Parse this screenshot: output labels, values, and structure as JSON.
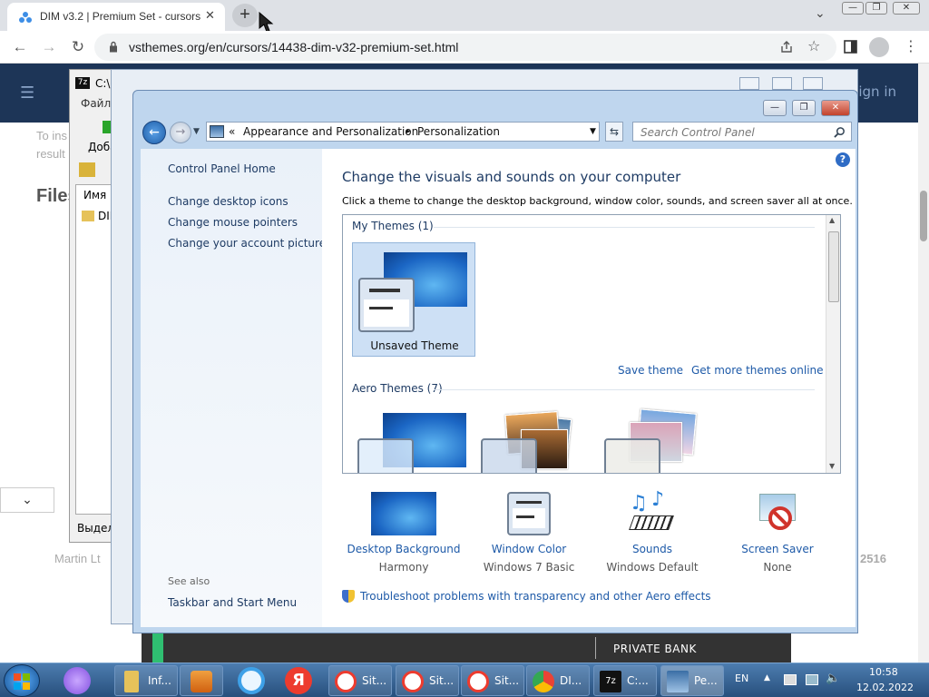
{
  "browser": {
    "tab_title": "DIM v3.2 | Premium Set - cursors",
    "tab_close": "✕",
    "new_tab": "+",
    "url": "vsthemes.org/en/cursors/14438-dim-v32-premium-set.html",
    "window_buttons": [
      "—",
      "❐",
      "✕"
    ],
    "nav": {
      "back": "←",
      "forward": "→",
      "reload": "↻"
    },
    "chevron": "⌄"
  },
  "site": {
    "login": "Sign in",
    "files_heading": "Files",
    "fragment_1": "To ins",
    "fragment_2": "result",
    "fragment_author": "Martin Lt",
    "fragment_num": "2516",
    "download_chevron": "⌄",
    "ad_text": "PRIVATE BANK"
  },
  "zip": {
    "title_fragment": "C:\\",
    "menu_file": "Файл",
    "add_label": "Доба",
    "column_name": "Имя",
    "folder_name": "DIM",
    "status": "Выдел"
  },
  "control_panel": {
    "breadcrumb_prefix": "«",
    "breadcrumb_1": "Appearance and Personalization",
    "breadcrumb_sep": "▸",
    "breadcrumb_2": "Personalization",
    "search_placeholder": "Search Control Panel",
    "left_links": [
      "Control Panel Home",
      "Change desktop icons",
      "Change mouse pointers",
      "Change your account picture"
    ],
    "see_also": "See also",
    "see_also_link": "Taskbar and Start Menu",
    "heading": "Change the visuals and sounds on your computer",
    "subheading": "Click a theme to change the desktop background, window color, sounds, and screen saver all at once.",
    "my_themes": "My Themes (1)",
    "unsaved_theme": "Unsaved Theme",
    "save_theme": "Save theme",
    "get_more": "Get more themes online",
    "aero_themes": "Aero Themes (7)",
    "bottom": [
      {
        "link": "Desktop Background",
        "sub": "Harmony"
      },
      {
        "link": "Window Color",
        "sub": "Windows 7 Basic"
      },
      {
        "link": "Sounds",
        "sub": "Windows Default"
      },
      {
        "link": "Screen Saver",
        "sub": "None"
      }
    ],
    "trouble": "Troubleshoot problems with transparency and other Aero effects"
  },
  "taskbar": {
    "items": [
      "Inf...",
      "",
      "",
      "",
      "Sit...",
      "Sit...",
      "Sit...",
      "DI...",
      "C:...",
      "Pe..."
    ],
    "lang": "EN",
    "time": "10:58",
    "date": "12.02.2022"
  }
}
